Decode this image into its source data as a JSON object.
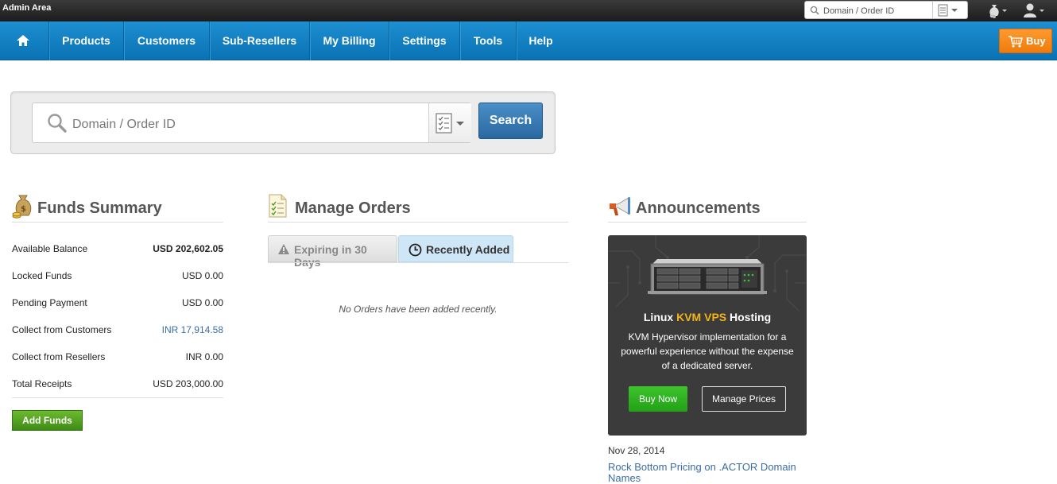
{
  "topbar": {
    "title": "Admin Area",
    "search_placeholder": "Domain / Order ID",
    "icons": [
      "magnifier-icon",
      "document-list-icon",
      "chevron-down-icon",
      "money-bag-icon",
      "user-icon"
    ]
  },
  "nav": {
    "home_icon": "home-icon",
    "items": [
      "Products",
      "Customers",
      "Sub-Resellers",
      "My Billing",
      "Settings",
      "Tools",
      "Help"
    ],
    "buy_label": "Buy",
    "buy_icon": "cart-icon"
  },
  "search": {
    "placeholder": "Domain / Order ID",
    "button_label": "Search"
  },
  "funds": {
    "title": "Funds Summary",
    "rows": [
      {
        "label": "Available Balance",
        "value": "USD 202,602.05"
      },
      {
        "label": "Locked Funds",
        "value": "USD 0.00"
      },
      {
        "label": "Pending Payment",
        "value": "USD 0.00"
      },
      {
        "label": "Collect from Customers",
        "value": "INR 17,914.58"
      },
      {
        "label": "Collect from Resellers",
        "value": "INR 0.00"
      },
      {
        "label": "Total Receipts",
        "value": "USD 203,000.00"
      }
    ],
    "add_funds_label": "Add Funds"
  },
  "orders": {
    "title": "Manage Orders",
    "tabs": [
      {
        "label": "Expiring in 30 Days"
      },
      {
        "label": "Recently Added"
      }
    ],
    "empty_message": "No Orders have been added recently."
  },
  "announcements": {
    "title": "Announcements",
    "card": {
      "title_prefix": "Linux ",
      "title_highlight": "KVM VPS",
      "title_suffix": " Hosting",
      "description": "KVM Hypervisor implementation for a powerful experience without the expense of a dedicated server.",
      "buy_label": "Buy Now",
      "manage_label": "Manage Prices"
    },
    "date": "Nov 28, 2014",
    "link": "Rock Bottom Pricing on .ACTOR Domain Names"
  },
  "colors": {
    "nav_blue": "#0a72b4",
    "buy_orange": "#f07b0c",
    "search_blue": "#2a679f",
    "add_funds_green": "#3e8b16",
    "link_blue": "#3a6ea5",
    "highlight_yellow": "#f3b419"
  }
}
